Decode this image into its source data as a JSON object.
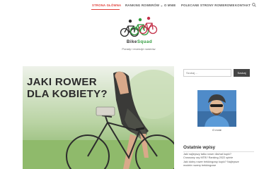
{
  "nav": {
    "items": [
      "STRONA GŁÓWNA",
      "RANKING ROWERÓW",
      "O MNIE",
      "POLECANE STRONY ROWEROWE",
      "KONTAKT"
    ],
    "dropdown_caret": "⌄",
    "search_icon": "search-icon",
    "active_color": "#e0403a"
  },
  "brand": {
    "name_part1": "Bike",
    "name_part2": "Squad",
    "tagline": "Porady i recenzje rowerów",
    "logo_icon": "bicycles-logo",
    "accent_color": "#2f9a3c"
  },
  "hero": {
    "title_line1": "JAKI ROWER",
    "title_line2": "DLA KOBIETY?"
  },
  "sidebar": {
    "search_placeholder": "Szukaj ...",
    "search_button": "Szukaj",
    "about_caption": "O mnie",
    "recent_title": "Ostatnie wpisy",
    "recent_posts": [
      "Jaki najlepszy tatko rower dla/nat kupić?",
      "Crossowy czy MTB? Ranking 2022 opinie",
      "Jaki dobry rower trekkingowy kupić? Najlepsze",
      "modele rowery trekkingowe"
    ]
  }
}
